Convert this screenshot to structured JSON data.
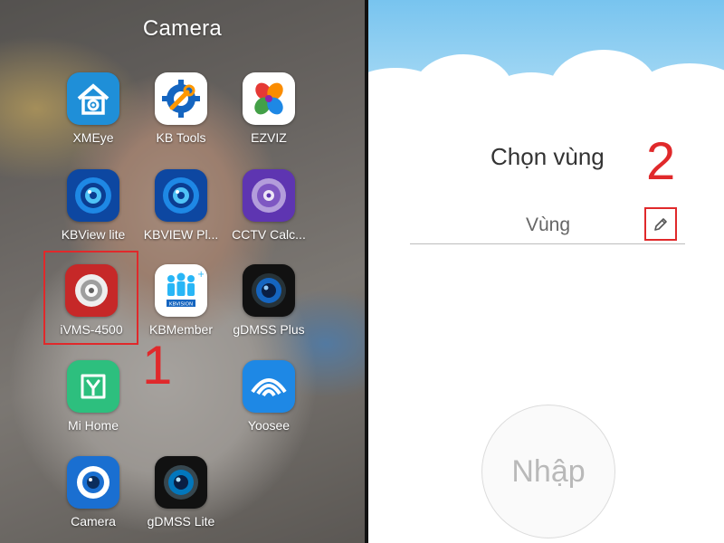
{
  "left_panel": {
    "folder_title": "Camera",
    "step_marker": "1",
    "apps": [
      {
        "label": "XMEye",
        "icon": "house-camera-icon"
      },
      {
        "label": "KB Tools",
        "icon": "wrench-gear-icon"
      },
      {
        "label": "EZVIZ",
        "icon": "petals-logo-icon"
      },
      {
        "label": "KBView lite",
        "icon": "camera-lens-icon"
      },
      {
        "label": "KBVIEW Pl...",
        "icon": "camera-lens-icon"
      },
      {
        "label": "CCTV Calc...",
        "icon": "disc-icon"
      },
      {
        "label": "iVMS-4500",
        "icon": "hikvision-eye-icon"
      },
      {
        "label": "KBMember",
        "icon": "people-icon",
        "icon_text": "KBVISION"
      },
      {
        "label": "gDMSS Plus",
        "icon": "camera-lens-icon"
      },
      {
        "label": "Mi Home",
        "icon": "mi-home-icon"
      },
      {
        "label": "",
        "icon": "empty-slot"
      },
      {
        "label": "Yoosee",
        "icon": "eye-arc-icon"
      },
      {
        "label": "Camera",
        "icon": "camera-icon"
      },
      {
        "label": "gDMSS Lite",
        "icon": "camera-lens-icon"
      }
    ]
  },
  "right_panel": {
    "title": "Chọn vùng",
    "step_marker": "2",
    "region_placeholder": "Vùng",
    "edit_icon": "pencil-icon",
    "enter_button": "Nhập"
  },
  "colors": {
    "highlight_red": "#e0292b",
    "sky_blue": "#78c4ef"
  }
}
